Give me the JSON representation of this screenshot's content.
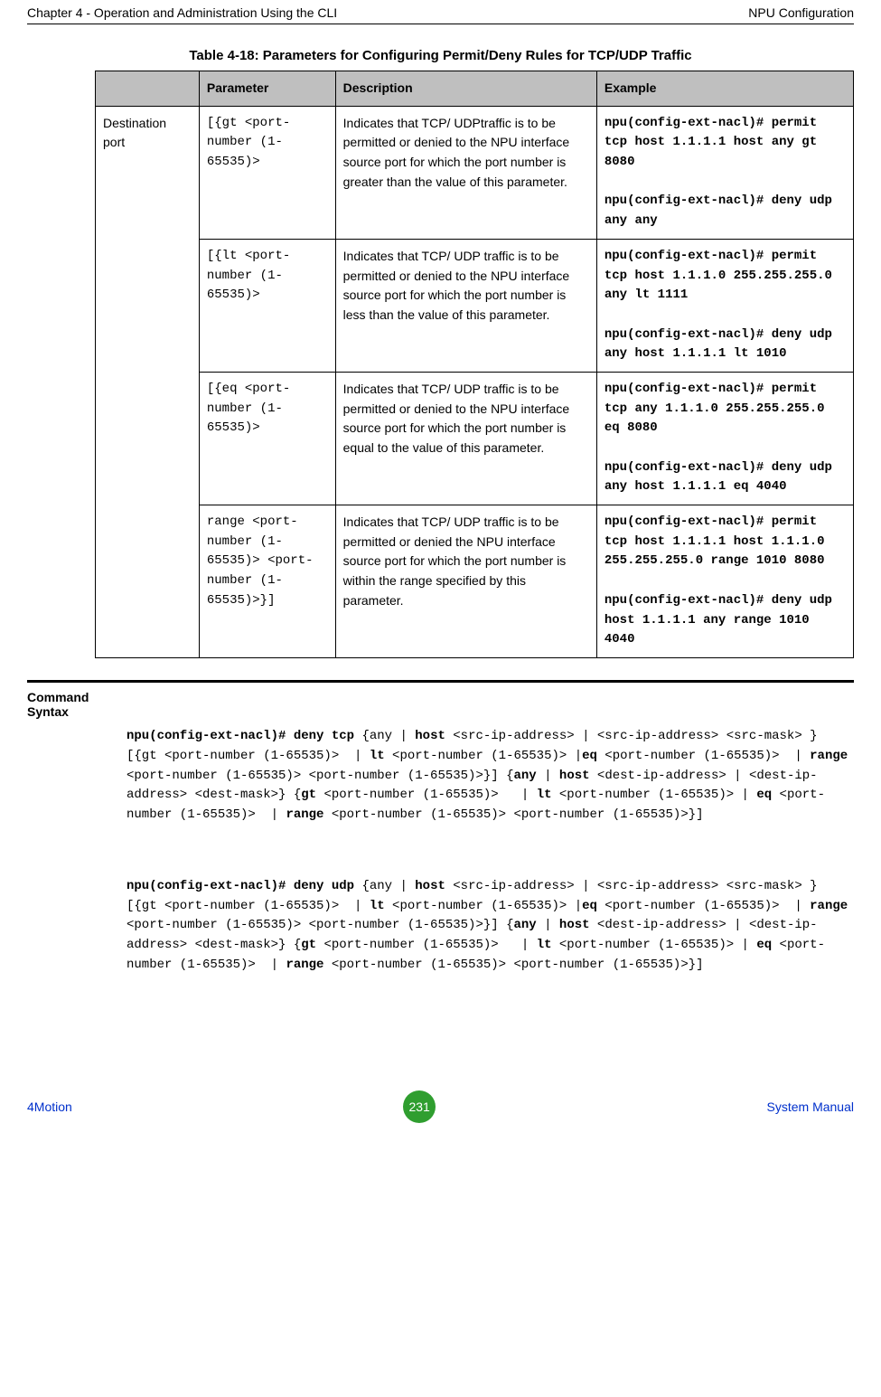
{
  "header": {
    "left": "Chapter 4 - Operation and Administration Using the CLI",
    "right": "NPU Configuration"
  },
  "tableTitle": "Table 4-18: Parameters for Configuring Permit/Deny Rules for TCP/UDP Traffic",
  "columns": {
    "c1": "",
    "c2": "Parameter",
    "c3": "Description",
    "c4": "Example"
  },
  "rowLabel": "Destination port",
  "rows": {
    "r1": {
      "param": "[{gt <port-number (1-65535)>",
      "desc": "Indicates that TCP/ UDPtraffic is to be permitted or denied to the NPU interface source port for which the port number is greater than the value of this parameter.",
      "ex1": "npu(config-ext-nacl)# permit tcp host 1.1.1.1 host any gt 8080",
      "ex2": "npu(config-ext-nacl)# deny udp any any"
    },
    "r2": {
      "param": "[{lt <port-number (1-65535)>",
      "desc": "Indicates that TCP/ UDP traffic is to be permitted or denied to the NPU interface source port for which the port number is less than the value of this parameter.",
      "ex1": "npu(config-ext-nacl)# permit tcp host 1.1.1.0 255.255.255.0 any lt 1111",
      "ex2": "npu(config-ext-nacl)# deny udp any host 1.1.1.1 lt 1010"
    },
    "r3": {
      "param": "[{eq <port-number (1-65535)>",
      "desc": "Indicates that TCP/ UDP traffic is to be permitted or denied to the NPU interface source port for which the port number is equal to the value of this parameter.",
      "ex1": "npu(config-ext-nacl)# permit tcp any 1.1.1.0 255.255.255.0 eq 8080",
      "ex2": "npu(config-ext-nacl)# deny udp any host 1.1.1.1 eq 4040"
    },
    "r4": {
      "param": "range <port-number (1-65535)> <port-number (1-65535)>}]",
      "desc": "Indicates that TCP/ UDP traffic is to be permitted or denied the NPU interface source port for which the port number is within the range specified by this parameter.",
      "ex1": "npu(config-ext-nacl)# permit tcp host 1.1.1.1 host 1.1.1.0 255.255.255.0 range 1010 8080",
      "ex2": "npu(config-ext-nacl)# deny udp host 1.1.1.1 any range 1010 4040"
    }
  },
  "commandSyntax": {
    "label1": "Command",
    "label2": "Syntax",
    "tcp_lead_b": "npu(config-ext-nacl)# deny tcp",
    "tcp_rest": " {any | host <src-ip-address> | <src-ip-address> <src-mask> } [{gt <port-number (1-65535)>  | lt <port-number (1-65535)> |eq <port-number (1-65535)>  | range <port-number (1-65535)> <port-number (1-65535)>}] {any | host <dest-ip-address> | <dest-ip-address> <dest-mask>} {gt <port-number (1-65535)>   | lt <port-number (1-65535)> | eq <port-number (1-65535)>  | range <port-number (1-65535)> <port-number (1-65535)>}]",
    "udp_lead_b": "npu(config-ext-nacl)# deny udp",
    "udp_rest": " {any | host <src-ip-address> | <src-ip-address> <src-mask> } [{gt <port-number (1-65535)>  | lt <port-number (1-65535)> |eq <port-number (1-65535)>  | range <port-number (1-65535)> <port-number (1-65535)>}] {any | host <dest-ip-address> | <dest-ip-address> <dest-mask>} {gt <port-number (1-65535)>   | lt <port-number (1-65535)> | eq <port-number (1-65535)>  | range <port-number (1-65535)> <port-number (1-65535)>}]"
  },
  "footer": {
    "left": "4Motion",
    "page": "231",
    "right": "System Manual"
  }
}
